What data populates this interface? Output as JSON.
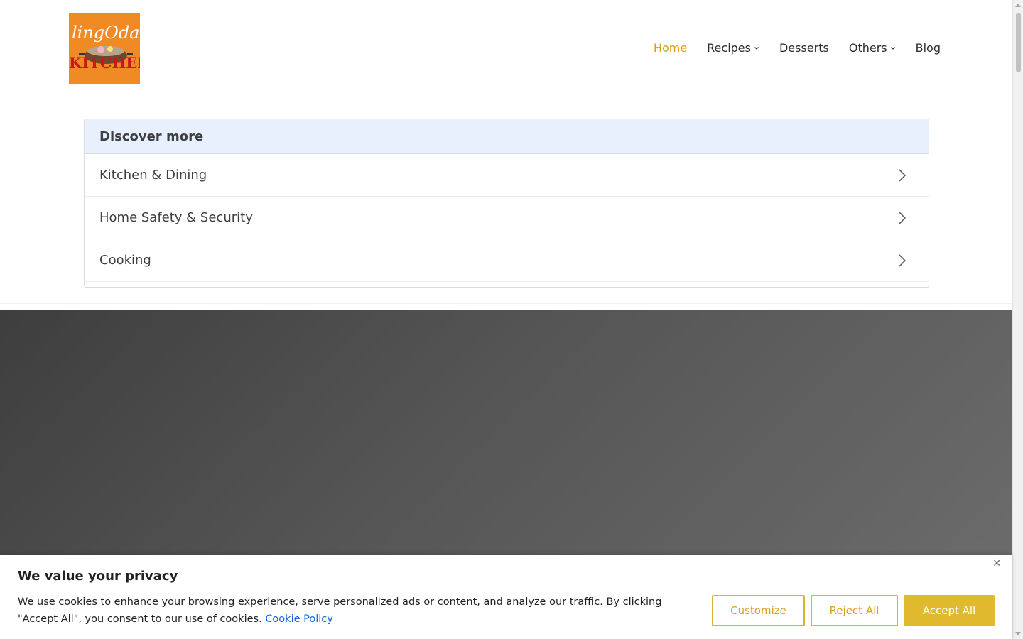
{
  "logo": {
    "top_text": "lingOda",
    "bottom_text": "KITCHEN",
    "bg_color": "#f08a24"
  },
  "nav": {
    "items": [
      {
        "label": "Home",
        "active": true
      },
      {
        "label": "Recipes",
        "dropdown": true
      },
      {
        "label": "Desserts"
      },
      {
        "label": "Others",
        "dropdown": true
      },
      {
        "label": "Blog"
      }
    ],
    "active_color": "#d7a21f"
  },
  "discover": {
    "title": "Discover more",
    "items": [
      {
        "label": "Kitchen & Dining"
      },
      {
        "label": "Home Safety & Security"
      },
      {
        "label": "Cooking"
      }
    ],
    "header_color": "#e8f0fe",
    "arrow_icon": "chevron-right-icon"
  },
  "cookie": {
    "title": "We value your privacy",
    "text": "We use cookies to enhance your browsing experience, serve personalized ads or content, and analyze our traffic. By clicking \"Accept All\", you consent to our use of cookies.",
    "link": "Cookie Policy",
    "close": "✕",
    "buttons": {
      "customize": "Customize",
      "reject": "Reject All",
      "accept": "Accept All"
    },
    "accent_color": "#e0b92e",
    "link_color": "#1863dc"
  }
}
